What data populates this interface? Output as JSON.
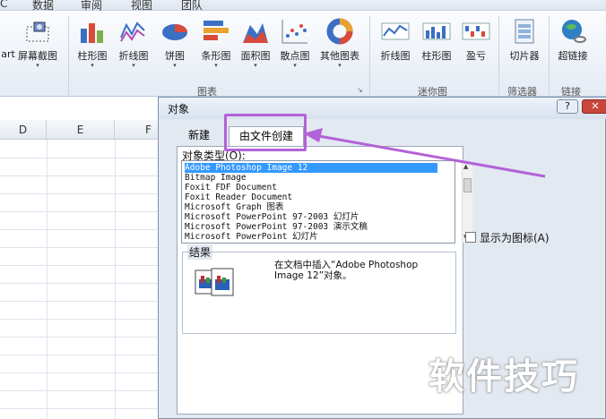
{
  "menu": {
    "tabs": [
      "C",
      "数据",
      "审阅",
      "视图",
      "团队"
    ]
  },
  "ribbon": {
    "buttons": [
      {
        "label": "art"
      },
      {
        "label": "屏幕截图"
      },
      {
        "label": "柱形图"
      },
      {
        "label": "折线图"
      },
      {
        "label": "饼图"
      },
      {
        "label": "条形图"
      },
      {
        "label": "面积图"
      },
      {
        "label": "散点图"
      },
      {
        "label": "其他图表"
      },
      {
        "label": "折线图"
      },
      {
        "label": "柱形图"
      },
      {
        "label": "盈亏"
      },
      {
        "label": "切片器"
      },
      {
        "label": "超链接"
      }
    ],
    "groups": {
      "charts": "图表",
      "sparklines": "迷你图",
      "filter": "筛选器",
      "links": "链接"
    }
  },
  "sheet": {
    "columns": [
      "D",
      "E",
      "F"
    ]
  },
  "dialog": {
    "title": "对象",
    "help_button": "?",
    "tabs": {
      "new": "新建",
      "from_file": "由文件创建"
    },
    "object_type_label": "对象类型(O):",
    "object_types": [
      "Adobe Photoshop Image 12",
      "Bitmap Image",
      "Foxit FDF Document",
      "Foxit Reader Document",
      "Microsoft Graph 图表",
      "Microsoft PowerPoint 97-2003 幻灯片",
      "Microsoft PowerPoint 97-2003 演示文稿",
      "Microsoft PowerPoint 幻灯片"
    ],
    "selected_index": 0,
    "display_as_icon_label": "显示为图标(A)",
    "result_label": "结果",
    "result_text_line1": "在文档中插入“Adobe Photoshop",
    "result_text_line2": "Image 12”对象。"
  },
  "watermark": "软件技巧",
  "colors": {
    "highlight": "#b362d8",
    "selection": "#3399ff"
  }
}
